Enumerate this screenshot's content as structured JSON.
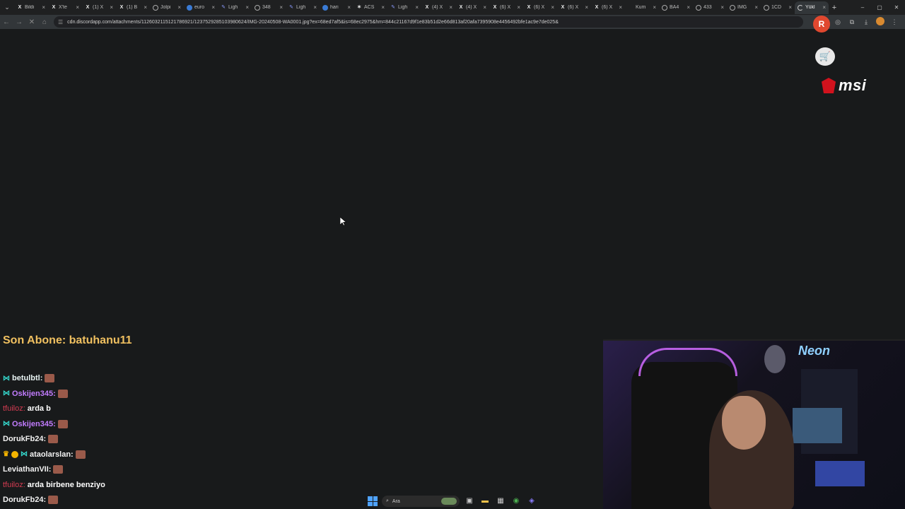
{
  "browser": {
    "tabs": [
      {
        "icon": "x-icon",
        "title": "Bildi"
      },
      {
        "icon": "x-icon",
        "title": "X'te"
      },
      {
        "icon": "x-icon",
        "title": "(1) X"
      },
      {
        "icon": "x-icon",
        "title": "(1) B"
      },
      {
        "icon": "globe-icon",
        "title": "Jolpi"
      },
      {
        "icon": "google-icon",
        "title": "euro"
      },
      {
        "icon": "pen-icon",
        "title": "Ligh"
      },
      {
        "icon": "globe-icon",
        "title": "348"
      },
      {
        "icon": "pen-icon",
        "title": "Ligh"
      },
      {
        "icon": "google-icon",
        "title": "hari"
      },
      {
        "icon": "star-icon",
        "title": "ACS"
      },
      {
        "icon": "pen-icon",
        "title": "Ligh"
      },
      {
        "icon": "x-icon",
        "title": "(4) X"
      },
      {
        "icon": "x-icon",
        "title": "(4) X"
      },
      {
        "icon": "x-icon",
        "title": "(6) X"
      },
      {
        "icon": "x-icon",
        "title": "(6) X"
      },
      {
        "icon": "x-icon",
        "title": "(6) X"
      },
      {
        "icon": "x-icon",
        "title": "(6) X"
      },
      {
        "icon": "blank-icon",
        "title": "Kum"
      },
      {
        "icon": "globe-icon",
        "title": "BA4"
      },
      {
        "icon": "globe-icon",
        "title": "433"
      },
      {
        "icon": "globe-icon",
        "title": "IMG"
      },
      {
        "icon": "globe-icon",
        "title": "1CD"
      },
      {
        "icon": "loading-icon",
        "title": "Yükl",
        "active": true
      }
    ],
    "new_tab_label": "+",
    "window_controls": [
      "–",
      "▢",
      "✕"
    ],
    "url": "cdn.discordapp.com/attachments/1126032115121786921/1237529285103980624/IMG-20240508-WA0001.jpg?ex=68ed7af5&is=68ec2975&hm=844c21167d9f1e83b51d2e66d813af20afa7395908e4456492bfe1ac9e7de025&"
  },
  "overlay": {
    "badge_letter": "R",
    "brand": "msi"
  },
  "chat": {
    "last_sub": "Son Abone: batuhanu11",
    "messages": [
      {
        "user": "betulbtl:",
        "color": "teal",
        "badges": [
          "sub"
        ],
        "text": ""
      },
      {
        "user": "Oskijen345:",
        "color": "purple",
        "badges": [
          "sub"
        ],
        "text": ""
      },
      {
        "user": "tfuiloz:",
        "color": "red",
        "badges": [],
        "text": "arda b"
      },
      {
        "user": "Oskijen345:",
        "color": "purple",
        "badges": [
          "sub"
        ],
        "text": ""
      },
      {
        "user": "DorukFb24:",
        "color": "white",
        "badges": [],
        "text": ""
      },
      {
        "user": "ataolarslan:",
        "color": "white",
        "badges": [
          "crown",
          "coin",
          "sub"
        ],
        "text": ""
      },
      {
        "user": "LeviathanVII:",
        "color": "white",
        "badges": [],
        "text": ""
      },
      {
        "user": "tfuiloz:",
        "color": "red",
        "badges": [],
        "text": "arda birbene benziyo"
      },
      {
        "user": "DorukFb24:",
        "color": "white",
        "badges": [],
        "text": ""
      }
    ]
  },
  "taskbar": {
    "search_placeholder": "Ara"
  }
}
